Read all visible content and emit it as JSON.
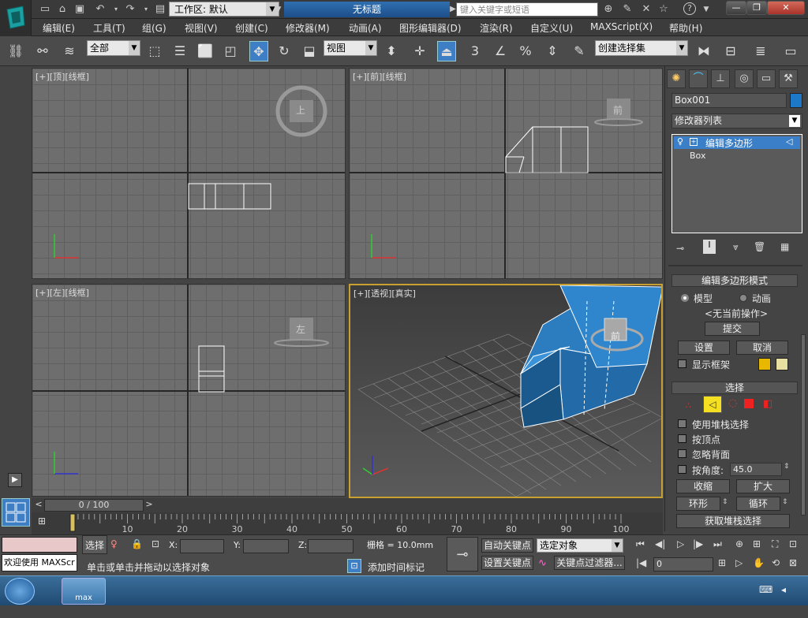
{
  "title_bar": {
    "workspace_label": "工作区: 默认",
    "doc_title": "无标题",
    "search_placeholder": "键入关键字或短语"
  },
  "menu": [
    "编辑(E)",
    "工具(T)",
    "组(G)",
    "视图(V)",
    "创建(C)",
    "修改器(M)",
    "动画(A)",
    "图形编辑器(D)",
    "渲染(R)",
    "自定义(U)",
    "MAXScript(X)",
    "帮助(H)"
  ],
  "toolbar": {
    "selection_filter": "全部",
    "ref_coord": "视图",
    "named_selection": "创建选择集",
    "snap_labels": [
      "3",
      "%"
    ]
  },
  "viewports": {
    "top": {
      "label": "[+][顶][线框]",
      "cube": "上"
    },
    "front": {
      "label": "[+][前][线框]",
      "cube": "前"
    },
    "left": {
      "label": "[+][左][线框]",
      "cube": "左"
    },
    "persp": {
      "label": "[+][透视][真实]",
      "cube": "前"
    }
  },
  "command_panel": {
    "object_name": "Box001",
    "object_color": "#1e78c8",
    "modifier_list": "修改器列表",
    "stack": [
      "编辑多边形",
      "Box"
    ],
    "rollout_mode": {
      "title": "编辑多边形模式",
      "radio_model": "模型",
      "radio_anim": "动画",
      "current_op": "<无当前操作>",
      "commit": "提交",
      "settings": "设置",
      "cancel": "取消",
      "show_cage": "显示框架",
      "cage_colors": [
        "#e8b800",
        "#e8e0a0"
      ]
    },
    "rollout_select": {
      "title": "选择",
      "use_stack": "使用堆栈选择",
      "by_vertex": "按顶点",
      "ignore_back": "忽略背面",
      "by_angle": "按角度:",
      "angle_value": "45.0",
      "shrink": "收缩",
      "grow": "扩大",
      "ring": "环形",
      "loop": "循环",
      "get_stack": "获取堆栈选择"
    }
  },
  "timeline": {
    "frame_display": "0 / 100",
    "ticks": [
      "10",
      "20",
      "30",
      "40",
      "50",
      "60",
      "70",
      "80",
      "90",
      "100"
    ]
  },
  "status": {
    "maxscript_listener": "欢迎使用 MAXScr",
    "selection_label": "选择",
    "x_label": "X:",
    "y_label": "Y:",
    "z_label": "Z:",
    "grid": "栅格 = 10.0mm",
    "prompt": "单击或单击并拖动以选择对象",
    "add_time_tag": "添加时间标记",
    "auto_key": "自动关键点",
    "set_key": "设置关键点",
    "key_target": "选定对象",
    "key_filters": "关键点过滤器...",
    "current_frame": "0"
  },
  "taskbar": {
    "app": "max"
  }
}
